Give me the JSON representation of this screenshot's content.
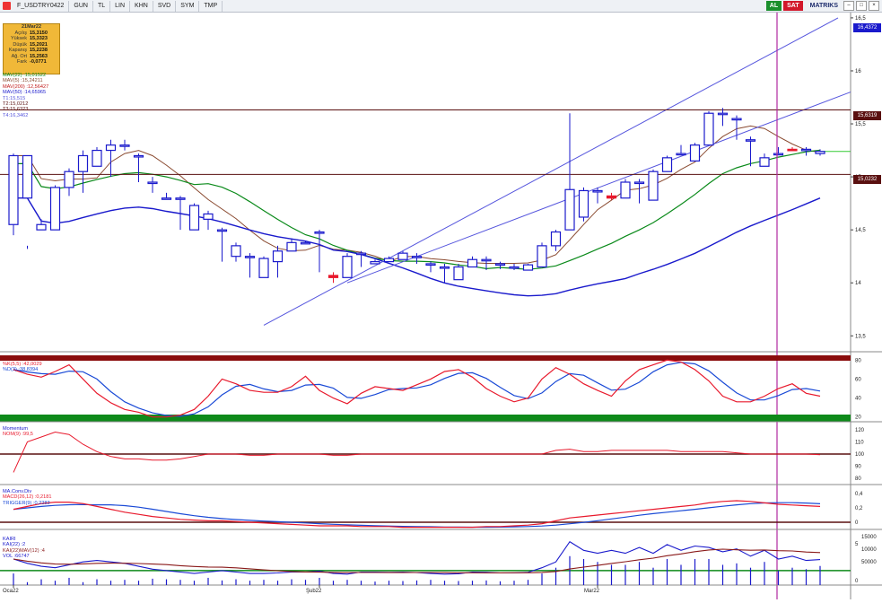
{
  "toolbar": {
    "symbol": "F_USDTRY0422",
    "period": "GUN",
    "currency": "TL",
    "scale_lin": "LIN",
    "khn": "KHN",
    "svd": "SVD",
    "sym": "SYM",
    "tmp": "TMP",
    "buy_label": "AL",
    "sell_label": "SAT",
    "matrix_label": "MATRIKS"
  },
  "infobox": {
    "date": "21Mar22",
    "rows": [
      {
        "k": "Açılış",
        "v": "15,3150"
      },
      {
        "k": "Yüksek",
        "v": "15,3323"
      },
      {
        "k": "Düşük",
        "v": "15,2021"
      },
      {
        "k": "Kapanış",
        "v": "15,2238"
      },
      {
        "k": "Ağ. Ort",
        "v": "15,2563"
      },
      {
        "k": "Fark",
        "v": "-0,0771"
      }
    ]
  },
  "legend": {
    "mav22": "MAV(22)",
    "mav22_val": ":15,01522",
    "mav5": "MAV(5)",
    "mav5_val": ":15,24211",
    "mav200": "MAV(200)",
    "mav200_val": ":12,56427",
    "mav50": "MAV(50)",
    "mav50_val": ":14,65965",
    "t1": "T1:15,515",
    "t2": "T2:15,0212",
    "t3": "T3:15,6323",
    "t4": "T4:16,3462"
  },
  "price_boxes": {
    "top": "16,4372",
    "mid": "15,6319",
    "low": "15,0232"
  },
  "stoch": {
    "k_label": "%K(5,5)",
    "k_val": ":42,0029",
    "d_label": "%D(3)",
    "d_val": ":38,8394"
  },
  "momentum": {
    "title": "Momentum",
    "nom_label": "NOM(9)",
    "nom_val": ":99,5"
  },
  "macd": {
    "title": "MA.Conv.Div",
    "macd_label": "MACD(26,12)",
    "macd_val": ":0,2181",
    "trig_label": "TRIGGER(9)",
    "trig_val": ":0,2283"
  },
  "kairi": {
    "title": "KAIRI",
    "k22": "KAI(22)",
    "k22_val": ":2",
    "kmav": "KAI(22)MAV(12)",
    "kmav_val": ":4",
    "vol": "VOL",
    "vol_val": ":66747"
  },
  "x_labels": [
    "Oca22",
    "Şub22",
    "Mar22"
  ],
  "colors": {
    "up": "#1a1acc",
    "down": "#e8192c",
    "mav22": "#0a8a1a",
    "mav5": "#8a4a30",
    "mav50": "#1a1acc",
    "channel": "#5555dd",
    "hline": "#5a1010",
    "cursor": "#b02aa0",
    "stoch_k": "#e8192c",
    "stoch_d": "#1a4ad6"
  },
  "chart_data": [
    {
      "type": "candlestick",
      "title": "F_USDTRY0422",
      "y_ticks": [
        13.5,
        14,
        14.5,
        15,
        15.5,
        16,
        16.5
      ],
      "y_tick_labels": [
        "13,5",
        "14",
        "14,5",
        "15",
        "15,5",
        "16",
        "16,5"
      ],
      "ylim": [
        13.35,
        16.55
      ],
      "x_date_labels": [
        "Oca22",
        "Şub22",
        "Mar22"
      ],
      "horizontal_lines": [
        15.6319,
        15.0232
      ],
      "ohlc": [
        [
          14.55,
          14.45,
          15.2,
          15.22
        ],
        [
          14.8,
          14.35,
          15.2,
          14.32
        ],
        [
          14.5,
          14.5,
          14.55,
          14.6
        ],
        [
          14.5,
          14.5,
          14.9,
          14.92
        ],
        [
          14.9,
          14.82,
          15.05,
          15.08
        ],
        [
          15.05,
          14.85,
          15.2,
          15.25
        ],
        [
          15.1,
          15.1,
          15.25,
          15.28
        ],
        [
          15.25,
          15.0,
          15.3,
          15.35
        ],
        [
          15.3,
          15.25,
          15.3,
          15.35
        ],
        [
          15.2,
          14.95,
          15.2,
          15.22
        ],
        [
          14.95,
          14.85,
          14.95,
          15.0
        ],
        [
          14.8,
          14.8,
          14.8,
          14.85
        ],
        [
          14.8,
          14.5,
          14.8,
          14.82
        ],
        [
          14.5,
          14.5,
          14.73,
          14.75
        ],
        [
          14.6,
          14.5,
          14.65,
          14.68
        ],
        [
          14.5,
          14.2,
          14.5,
          14.52
        ],
        [
          14.25,
          14.2,
          14.35,
          14.38
        ],
        [
          14.25,
          14.05,
          14.25,
          14.28
        ],
        [
          14.05,
          14.05,
          14.23,
          14.25
        ],
        [
          14.2,
          14.05,
          14.3,
          14.35
        ],
        [
          14.3,
          14.3,
          14.38,
          14.42
        ],
        [
          14.38,
          14.38,
          14.38,
          14.4
        ],
        [
          14.48,
          14.1,
          14.48,
          14.5
        ],
        [
          14.07,
          14.0,
          14.05,
          14.1
        ],
        [
          14.05,
          14.05,
          14.25,
          14.28
        ],
        [
          14.28,
          14.15,
          14.28,
          14.3
        ],
        [
          14.18,
          14.18,
          14.2,
          14.22
        ],
        [
          14.2,
          14.2,
          14.23,
          14.25
        ],
        [
          14.22,
          14.22,
          14.28,
          14.3
        ],
        [
          14.25,
          14.18,
          14.25,
          14.28
        ],
        [
          14.18,
          14.1,
          14.18,
          14.2
        ],
        [
          14.15,
          14.0,
          14.15,
          14.18
        ],
        [
          14.03,
          14.03,
          14.15,
          14.18
        ],
        [
          14.15,
          14.15,
          14.22,
          14.25
        ],
        [
          14.22,
          14.12,
          14.22,
          14.25
        ],
        [
          14.18,
          14.13,
          14.18,
          14.2
        ],
        [
          14.15,
          14.12,
          14.15,
          14.18
        ],
        [
          14.12,
          14.12,
          14.17,
          14.18
        ],
        [
          14.15,
          14.15,
          14.35,
          14.38
        ],
        [
          14.35,
          14.3,
          14.48,
          14.5
        ],
        [
          14.5,
          14.5,
          14.88,
          15.6
        ],
        [
          14.62,
          14.58,
          14.87,
          14.9
        ],
        [
          14.87,
          14.75,
          14.87,
          14.9
        ],
        [
          14.82,
          14.78,
          14.8,
          14.85
        ],
        [
          14.8,
          14.8,
          14.95,
          14.98
        ],
        [
          14.95,
          14.75,
          14.95,
          14.98
        ],
        [
          14.78,
          14.78,
          15.05,
          15.07
        ],
        [
          15.05,
          15.05,
          15.18,
          15.2
        ],
        [
          15.22,
          15.22,
          15.22,
          15.3
        ],
        [
          15.15,
          15.15,
          15.3,
          15.32
        ],
        [
          15.3,
          15.3,
          15.6,
          15.62
        ],
        [
          15.6,
          15.48,
          15.6,
          15.65
        ],
        [
          15.55,
          15.35,
          15.55,
          15.58
        ],
        [
          15.35,
          15.1,
          15.35,
          15.38
        ],
        [
          15.1,
          15.1,
          15.18,
          15.22
        ],
        [
          15.22,
          15.22,
          15.22,
          15.28
        ],
        [
          15.26,
          15.26,
          15.25,
          15.28
        ],
        [
          15.26,
          15.2,
          15.26,
          15.28
        ],
        [
          15.22,
          15.2,
          15.24,
          15.26
        ]
      ],
      "moving_averages": [
        {
          "name": "MAV(22)",
          "last": 15.01522
        },
        {
          "name": "MAV(5)",
          "last": 15.24211
        },
        {
          "name": "MAV(200)",
          "last": 12.56427
        },
        {
          "name": "MAV(50)",
          "last": 14.65965
        }
      ]
    },
    {
      "type": "line",
      "name": "Stochastic",
      "yticks": [
        20,
        40,
        60,
        80
      ],
      "series": [
        {
          "name": "%K(5,5)",
          "last": 42.0029
        },
        {
          "name": "%D(3)",
          "last": 38.8394
        }
      ]
    },
    {
      "type": "line",
      "name": "Momentum",
      "yticks": [
        80,
        90,
        100,
        110,
        120
      ],
      "series": [
        {
          "name": "NOM(9)",
          "last": 99.5
        }
      ]
    },
    {
      "type": "line",
      "name": "MA.Conv.Div",
      "yticks": [
        0,
        0.2,
        0.4
      ],
      "series": [
        {
          "name": "MACD(26,12)",
          "last": 0.2181
        },
        {
          "name": "TRIGGER(9)",
          "last": 0.2283
        }
      ]
    },
    {
      "type": "bar",
      "name": "KAIRI / VOL",
      "yticks": [
        0,
        5,
        10000,
        15000
      ],
      "series": [
        {
          "name": "KAI(22)",
          "last": 2
        },
        {
          "name": "KAI(22)MAV(12)",
          "last": 4
        },
        {
          "name": "VOL",
          "last": 66747
        }
      ]
    }
  ]
}
